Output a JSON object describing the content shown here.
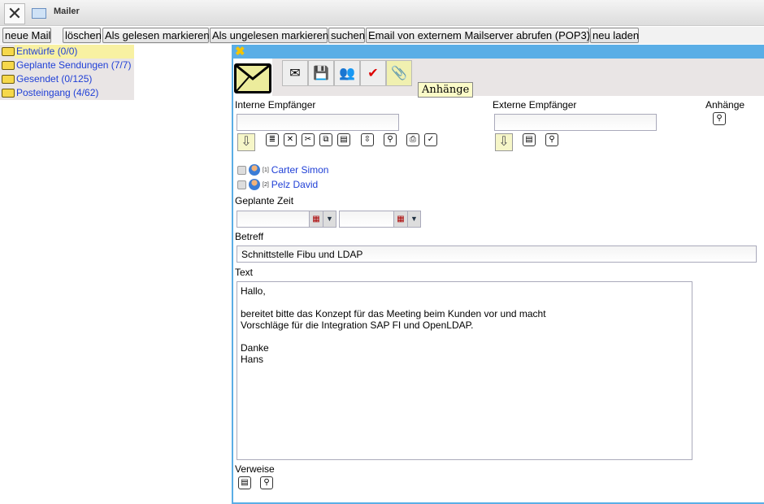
{
  "window": {
    "title": "Mailer"
  },
  "toolbar": [
    {
      "label": "neue Mail"
    },
    {
      "label": "löschen"
    },
    {
      "label": "Als gelesen markieren"
    },
    {
      "label": "Als ungelesen markieren"
    },
    {
      "label": "suchen"
    },
    {
      "label": "Email von externem Mailserver abrufen (POP3)"
    },
    {
      "label": "neu laden"
    }
  ],
  "folders": [
    {
      "label": "Entwürfe (0/0)",
      "selected": true
    },
    {
      "label": "Geplante Sendungen (7/7)"
    },
    {
      "label": "Gesendet (0/125)"
    },
    {
      "label": "Posteingang (4/62)"
    }
  ],
  "compose": {
    "tooltip": "Anhänge",
    "internal_label": "Interne Empfänger",
    "internal_value": "",
    "external_label": "Externe Empfänger",
    "external_value": "",
    "attachments_label": "Anhänge",
    "recipients": [
      {
        "index": "[1]",
        "name": "Carter Simon"
      },
      {
        "index": "[2]",
        "name": "Pelz David"
      }
    ],
    "scheduled_label": "Geplante Zeit",
    "date_value": "",
    "time_value": "",
    "subject_label": "Betreff",
    "subject": "Schnittstelle Fibu und LDAP",
    "text_label": "Text",
    "text": "Hallo,\n\nbereitet bitte das Konzept für das Meeting beim Kunden vor und macht\nVorschläge für die Integration SAP FI und OpenLDAP.\n\nDanke\nHans",
    "references_label": "Verweise"
  },
  "colors": {
    "accent": "#5aaee6",
    "selected": "#f8f1a2",
    "link": "#1f3fd6"
  }
}
